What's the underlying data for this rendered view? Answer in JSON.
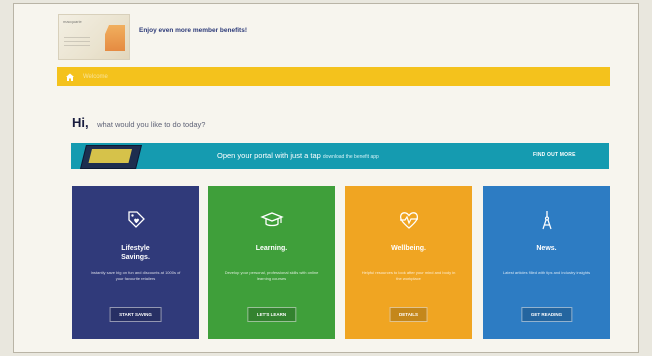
{
  "promo": {
    "card_brand": "macquarie",
    "message": "Enjoy even more member benefits!"
  },
  "nav": {
    "home_icon": "home-icon",
    "label": "Welcome"
  },
  "greeting": {
    "hi": "Hi,",
    "question": "what would you like to do today?"
  },
  "banner": {
    "text": "Open your portal with just a tap",
    "small_text": "download the benefit app",
    "link_label": "FIND OUT MORE"
  },
  "tiles": [
    {
      "title": "Lifestyle\nSavings.",
      "description": "Instantly save big on fun and discounts at 1000s of your favourite retailers",
      "button": "START SAVING",
      "icon": "tag-heart-icon",
      "color": "#303a7a"
    },
    {
      "title": "Learning.",
      "description": "Develop your personal, professional skills with online learning courses",
      "button": "LET'S LEARN",
      "icon": "graduation-cap-icon",
      "color": "#3f9f3a"
    },
    {
      "title": "Wellbeing.",
      "description": "Helpful resources to look after your mind and body in the workplace",
      "button": "DETAILS",
      "icon": "heart-pulse-icon",
      "color": "#f0a522"
    },
    {
      "title": "News.",
      "description": "Latest articles filled with tips and industry insights",
      "button": "GET READING",
      "icon": "news-icon",
      "color": "#2d7cc3"
    }
  ]
}
